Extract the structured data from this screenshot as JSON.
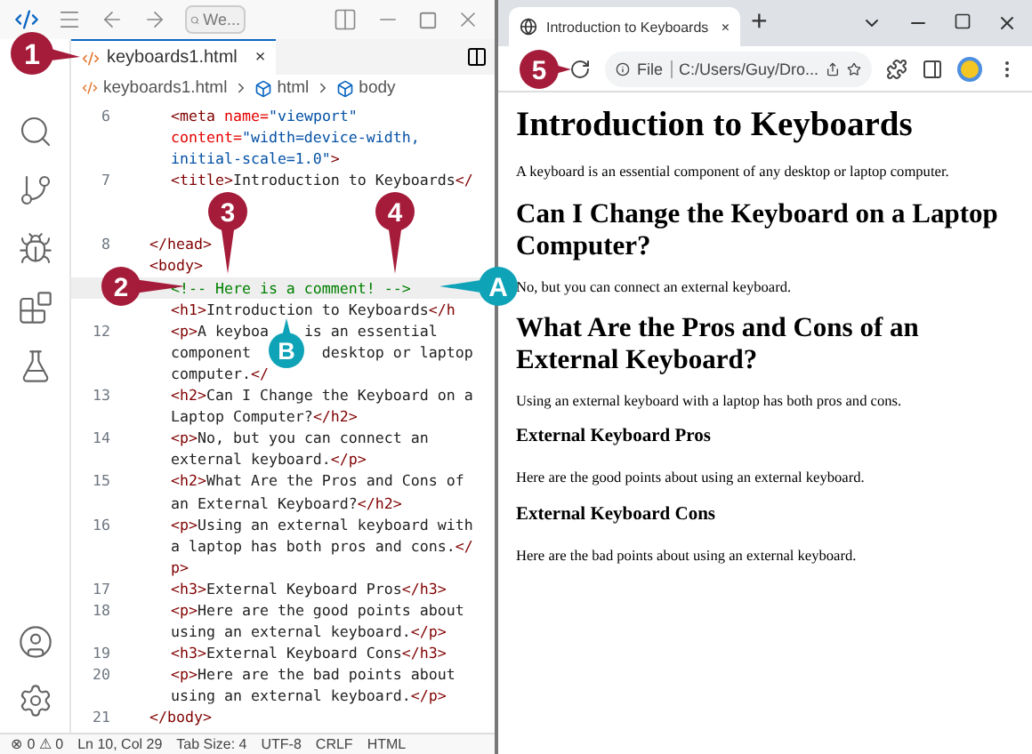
{
  "editor": {
    "title_bar": {
      "search": "We..."
    },
    "tab": {
      "label": "keyboards1.html",
      "close": "×",
      "selected": true
    },
    "breadcrumb": [
      "keyboards1.html",
      "html",
      "body"
    ],
    "lines": [
      {
        "number": "6",
        "rows": [
          [
            {
              "kind": "tag",
              "text": "<meta "
            },
            {
              "kind": "attr",
              "text": "name="
            },
            {
              "kind": "str",
              "text": "\"viewport\""
            }
          ],
          [
            {
              "kind": "attr",
              "text": "content="
            },
            {
              "kind": "str",
              "text": "\"width=device-width,"
            }
          ],
          [
            {
              "kind": "str",
              "text": "initial-scale=1.0\""
            },
            {
              "kind": "tag",
              "text": ">"
            }
          ]
        ]
      },
      {
        "number": "7",
        "rows": [
          [
            {
              "kind": "tag",
              "text": "<title>"
            },
            {
              "kind": "text",
              "text": "Introduction to Keyboards"
            },
            {
              "kind": "tag",
              "text": "</"
            }
          ],
          []
        ]
      },
      {
        "number": "8",
        "outdent": true,
        "rows": [
          [
            {
              "kind": "tag",
              "text": "</head>"
            }
          ]
        ]
      },
      {
        "outdent": true,
        "rows": [
          [
            {
              "kind": "tag",
              "text": "<body>"
            }
          ]
        ]
      },
      {
        "current": true,
        "rows": [
          [
            {
              "kind": "comment",
              "text": "<!-- Here is a comment! -->"
            }
          ]
        ]
      },
      {
        "rows": [
          [
            {
              "kind": "tag",
              "text": "<h1>"
            },
            {
              "kind": "text",
              "text": "Introduction to Keyboards"
            },
            {
              "kind": "tag",
              "text": "</h"
            }
          ]
        ]
      },
      {
        "number": "12",
        "rows": [
          [
            {
              "kind": "tag",
              "text": "<p>"
            },
            {
              "kind": "text",
              "text": "A keyboa"
            },
            {
              "kind": "gap"
            },
            {
              "kind": "text",
              "text": "is an essential"
            }
          ],
          [
            {
              "kind": "text",
              "text": "component"
            },
            {
              "kind": "gap"
            },
            {
              "kind": "text",
              "text": "desktop or laptop"
            }
          ],
          [
            {
              "kind": "text",
              "text": "computer."
            },
            {
              "kind": "tag",
              "text": "</"
            }
          ]
        ]
      },
      {
        "number": "13",
        "rows": [
          [
            {
              "kind": "tag",
              "text": "<h2>"
            },
            {
              "kind": "text",
              "text": "Can I Change the Keyboard on a"
            }
          ],
          [
            {
              "kind": "text",
              "text": "Laptop Computer?"
            },
            {
              "kind": "tag",
              "text": "</h2>"
            }
          ]
        ]
      },
      {
        "number": "14",
        "rows": [
          [
            {
              "kind": "tag",
              "text": "<p>"
            },
            {
              "kind": "text",
              "text": "No, but you can connect an"
            }
          ],
          [
            {
              "kind": "text",
              "text": "external keyboard."
            },
            {
              "kind": "tag",
              "text": "</p>"
            }
          ]
        ]
      },
      {
        "number": "15",
        "rows": [
          [
            {
              "kind": "tag",
              "text": "<h2>"
            },
            {
              "kind": "text",
              "text": "What Are the Pros and Cons of"
            }
          ],
          [
            {
              "kind": "text",
              "text": "an External Keyboard?"
            },
            {
              "kind": "tag",
              "text": "</h2>"
            }
          ]
        ]
      },
      {
        "number": "16",
        "rows": [
          [
            {
              "kind": "tag",
              "text": "<p>"
            },
            {
              "kind": "text",
              "text": "Using an external keyboard with"
            }
          ],
          [
            {
              "kind": "text",
              "text": "a laptop has both pros and cons."
            },
            {
              "kind": "tag",
              "text": "</"
            }
          ],
          [
            {
              "kind": "tag",
              "text": "p>"
            }
          ]
        ]
      },
      {
        "number": "17",
        "rows": [
          [
            {
              "kind": "tag",
              "text": "<h3>"
            },
            {
              "kind": "text",
              "text": "External Keyboard Pros"
            },
            {
              "kind": "tag",
              "text": "</h3>"
            }
          ]
        ]
      },
      {
        "number": "18",
        "rows": [
          [
            {
              "kind": "tag",
              "text": "<p>"
            },
            {
              "kind": "text",
              "text": "Here are the good points about"
            }
          ],
          [
            {
              "kind": "text",
              "text": "using an external keyboard."
            },
            {
              "kind": "tag",
              "text": "</p>"
            }
          ]
        ]
      },
      {
        "number": "19",
        "rows": [
          [
            {
              "kind": "tag",
              "text": "<h3>"
            },
            {
              "kind": "text",
              "text": "External Keyboard Cons"
            },
            {
              "kind": "tag",
              "text": "</h3>"
            }
          ]
        ]
      },
      {
        "number": "20",
        "rows": [
          [
            {
              "kind": "tag",
              "text": "<p>"
            },
            {
              "kind": "text",
              "text": "Here are the bad points about"
            }
          ],
          [
            {
              "kind": "text",
              "text": "using an external keyboard."
            },
            {
              "kind": "tag",
              "text": "</p>"
            }
          ]
        ]
      },
      {
        "number": "21",
        "outdent": true,
        "rows": [
          [
            {
              "kind": "tag",
              "text": "</body>"
            }
          ]
        ]
      }
    ],
    "status_bar": [
      "⊗ 0 ⚠ 0",
      "Ln 10, Col 29",
      "Tab Size: 4",
      "UTF-8",
      "CRLF",
      "HTML"
    ]
  },
  "browser": {
    "tab": {
      "title": "Introduction to Keyboards",
      "close": "×",
      "selected": true
    },
    "new_tab": "+",
    "address": {
      "scheme": "File",
      "url": "C:/Users/Guy/Dro..."
    },
    "page": [
      {
        "kind": "h1",
        "text": "Introduction to Keyboards"
      },
      {
        "kind": "p",
        "text": "A keyboard is an essential component of any desktop or laptop computer."
      },
      {
        "kind": "h2",
        "text": "Can I Change the Keyboard on a Laptop Computer?"
      },
      {
        "kind": "p",
        "text": "No, but you can connect an external keyboard."
      },
      {
        "kind": "h2",
        "text": "What Are the Pros and Cons of an External Keyboard?"
      },
      {
        "kind": "p",
        "text": "Using an external keyboard with a laptop has both pros and cons."
      },
      {
        "kind": "h3",
        "text": "External Keyboard Pros"
      },
      {
        "kind": "p",
        "text": "Here are the good points about using an external keyboard."
      },
      {
        "kind": "h3",
        "text": "External Keyboard Cons"
      },
      {
        "kind": "p",
        "text": "Here are the bad points about using an external keyboard."
      }
    ]
  },
  "callouts": [
    {
      "label": "1",
      "color": "#a51c3a"
    },
    {
      "label": "2",
      "color": "#a51c3a"
    },
    {
      "label": "3",
      "color": "#a51c3a"
    },
    {
      "label": "4",
      "color": "#a51c3a"
    },
    {
      "label": "5",
      "color": "#a51c3a"
    },
    {
      "label": "A",
      "color": "#0fa3b8"
    },
    {
      "label": "B",
      "color": "#0fa3b8"
    }
  ]
}
